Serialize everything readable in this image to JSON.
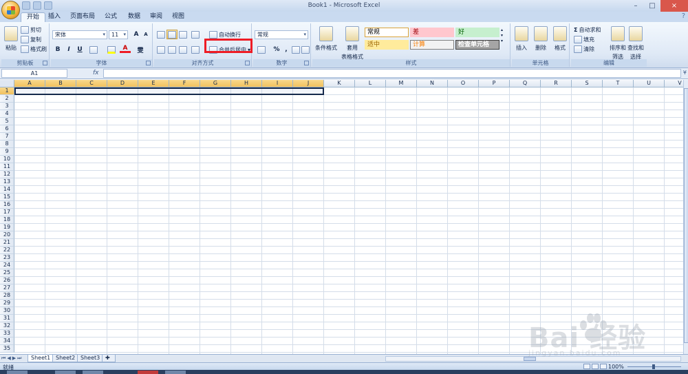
{
  "window": {
    "title": "Book1 - Microsoft Excel",
    "controls": [
      "–",
      "□",
      "×"
    ]
  },
  "ribbon_tabs": [
    "开始",
    "插入",
    "页面布局",
    "公式",
    "数据",
    "审阅",
    "视图"
  ],
  "active_tab": "开始",
  "clipboard": {
    "paste": "粘贴",
    "cut": "剪切",
    "copy": "复制",
    "format_painter": "格式刷",
    "label": "剪贴板"
  },
  "font": {
    "name": "宋体",
    "size": "11",
    "grow": "A",
    "shrink": "A",
    "bold": "B",
    "italic": "I",
    "underline": "U",
    "wen": "雯",
    "label": "字体"
  },
  "alignment": {
    "wrap_text": "自动换行",
    "merge_center": "合并后居中",
    "label": "对齐方式"
  },
  "number": {
    "format": "常规",
    "percent": "%",
    "comma": ",",
    "label": "数字"
  },
  "styles": {
    "conditional_formatting": "条件格式",
    "format_as_table_1": "套用",
    "format_as_table_2": "表格格式",
    "cells": [
      {
        "text": "常规",
        "bg": "#ffffff",
        "color": "#000000",
        "border": "#d9a33a"
      },
      {
        "text": "差",
        "bg": "#ffc7ce",
        "color": "#9c0006",
        "border": "#ffc7ce"
      },
      {
        "text": "好",
        "bg": "#c6efce",
        "color": "#006100",
        "border": "#c6efce"
      },
      {
        "text": "适中",
        "bg": "#ffeb9c",
        "color": "#9c6500",
        "border": "#ffeb9c"
      },
      {
        "text": "计算",
        "bg": "#f2f2f2",
        "color": "#fa7d00",
        "border": "#7f7f7f"
      },
      {
        "text": "检查单元格",
        "bg": "#a5a5a5",
        "color": "#ffffff",
        "border": "#3f3f3f"
      }
    ],
    "label": "样式"
  },
  "cells_group": {
    "insert": "插入",
    "delete": "删除",
    "format": "格式",
    "label": "单元格"
  },
  "editing": {
    "autosum": "自动求和",
    "fill": "填充",
    "clear": "清除",
    "sort_1": "排序和",
    "sort_2": "筛选",
    "find_1": "查找和",
    "find_2": "选择",
    "label": "编辑"
  },
  "formula_bar": {
    "name_box": "A1",
    "fx": "fx",
    "value": ""
  },
  "grid": {
    "columns": [
      "A",
      "B",
      "C",
      "D",
      "E",
      "F",
      "G",
      "H",
      "I",
      "J",
      "K",
      "L",
      "M",
      "N",
      "O",
      "P",
      "Q",
      "R",
      "S",
      "T",
      "U",
      "V"
    ],
    "selected_columns": [
      "A",
      "B",
      "C",
      "D",
      "E",
      "F",
      "G",
      "H",
      "I",
      "J"
    ],
    "rows": [
      "1",
      "2",
      "3",
      "4",
      "5",
      "6",
      "7",
      "8",
      "9",
      "10",
      "11",
      "12",
      "13",
      "14",
      "15",
      "16",
      "17",
      "18",
      "19",
      "20",
      "21",
      "22",
      "23",
      "24",
      "25",
      "26",
      "27",
      "28",
      "29",
      "30",
      "31",
      "32",
      "33",
      "34",
      "35"
    ],
    "selected_row": "1"
  },
  "sheets": [
    "Sheet1",
    "Sheet2",
    "Sheet3"
  ],
  "active_sheet": "Sheet1",
  "status": {
    "text": "就绪",
    "zoom": "100%"
  },
  "watermark": {
    "main": "Bai  经验",
    "sub": "jingyan.baidu.com"
  },
  "colors": {
    "highlight_box": "#ee1c25",
    "ribbon_bg": "#dfe9f6",
    "header_selected": "#f1c15f"
  }
}
